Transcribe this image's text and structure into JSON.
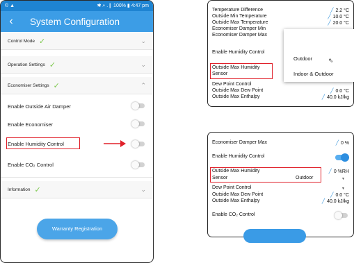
{
  "phone": {
    "status_bar": {
      "left": "© ▲",
      "right": "✱ ⌕ .❙ 100% ▮ 4:47 pm"
    },
    "header": {
      "back_icon": "back-arrow-icon",
      "title": "System Configuration"
    },
    "sections": {
      "control_mode": "Control Mode",
      "operation_settings": "Operation Settings",
      "economiser_settings": "Economiser Settings",
      "information": "Information"
    },
    "check_icon": "✓",
    "rows": {
      "outside_air_damper": "Enable Outside Air Damper",
      "economiser": "Enable Economiser",
      "humidity_control": "Enable Humidity Control",
      "co2_control": "Enable CO₂ Control"
    },
    "warranty_button": "Warranty Registration",
    "colors": {
      "header": "#3c9de6",
      "status": "#1e84d2",
      "highlight": "#e0202a",
      "check": "#7cc84c"
    }
  },
  "panel_top": {
    "rows": [
      {
        "label": "Temperature Difference",
        "value": "2.2 °C"
      },
      {
        "label": "Outside Min Temperature",
        "value": "10.0 °C"
      },
      {
        "label": "Outside Max Temperature",
        "value": "20.0 °C"
      },
      {
        "label": "Economiser Damper Min",
        "value": ""
      },
      {
        "label": "Economiser Damper Max",
        "value": ""
      }
    ],
    "humidity_control": "Enable Humidity Control",
    "sensor_label_line1": "Outside Max Humidity",
    "sensor_label_line2": "Sensor",
    "dew_point_control": "Dew Point Control",
    "max_dew_point": {
      "label": "Outside Max Dew Point",
      "value": "0.0 °C"
    },
    "max_enthalpy": {
      "label": "Outside Max Enthalpy",
      "value": "40.0 kJ/kg"
    },
    "dropdown": {
      "options": [
        "Outdoor",
        "Indoor & Outdoor"
      ],
      "cursor_icon": "pointer-cursor-icon"
    }
  },
  "panel_bottom": {
    "damper_max": {
      "label": "Economiser Damper Max",
      "value": "0 %"
    },
    "humidity_control": "Enable Humidity Control",
    "max_humidity": {
      "label": "Outside Max Humidity",
      "value": "0 %RH"
    },
    "sensor": {
      "label": "Sensor",
      "value": "Outdoor"
    },
    "dew_point_control": "Dew Point Control",
    "max_dew_point": {
      "label": "Outside Max Dew Point",
      "value": "0.0 °C"
    },
    "max_enthalpy": {
      "label": "Outside Max Enthalpy",
      "value": "40.0 kJ/kg"
    },
    "co2_control": "Enable CO₂ Control"
  },
  "glyphs": {
    "pencil": "╱",
    "caret": "▼",
    "chevron_down": "⌄",
    "chevron_up": "⌃",
    "cursor": "⇖"
  }
}
